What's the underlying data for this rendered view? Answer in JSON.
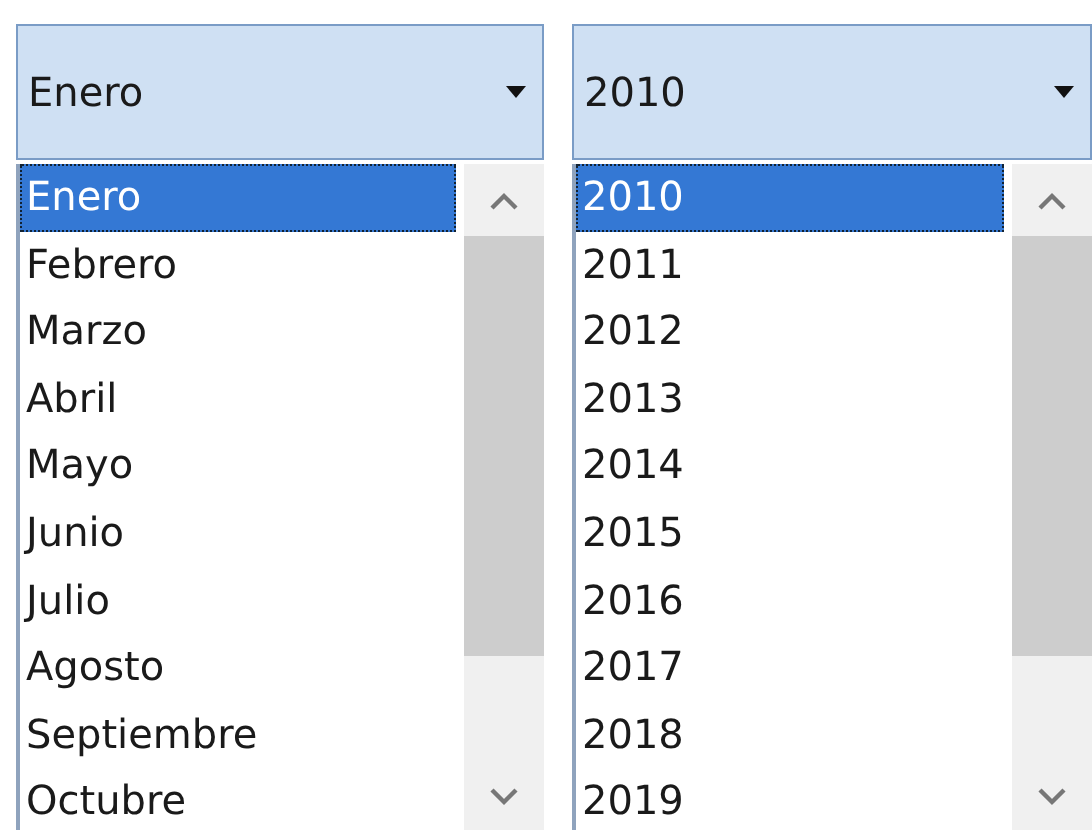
{
  "dropdowns": [
    {
      "value": "Enero",
      "expanded": true,
      "options": [
        {
          "label": "Enero",
          "selected": true
        },
        {
          "label": "Febrero",
          "selected": false
        },
        {
          "label": "Marzo",
          "selected": false
        },
        {
          "label": "Abril",
          "selected": false
        },
        {
          "label": "Mayo",
          "selected": false
        },
        {
          "label": "Junio",
          "selected": false
        },
        {
          "label": "Julio",
          "selected": false
        },
        {
          "label": "Agosto",
          "selected": false
        },
        {
          "label": "Septiembre",
          "selected": false
        },
        {
          "label": "Octubre",
          "selected": false
        }
      ]
    },
    {
      "value": "2010",
      "expanded": true,
      "options": [
        {
          "label": "2010",
          "selected": true
        },
        {
          "label": "2011",
          "selected": false
        },
        {
          "label": "2012",
          "selected": false
        },
        {
          "label": "2013",
          "selected": false
        },
        {
          "label": "2014",
          "selected": false
        },
        {
          "label": "2015",
          "selected": false
        },
        {
          "label": "2016",
          "selected": false
        },
        {
          "label": "2017",
          "selected": false
        },
        {
          "label": "2018",
          "selected": false
        },
        {
          "label": "2019",
          "selected": false
        }
      ]
    }
  ]
}
